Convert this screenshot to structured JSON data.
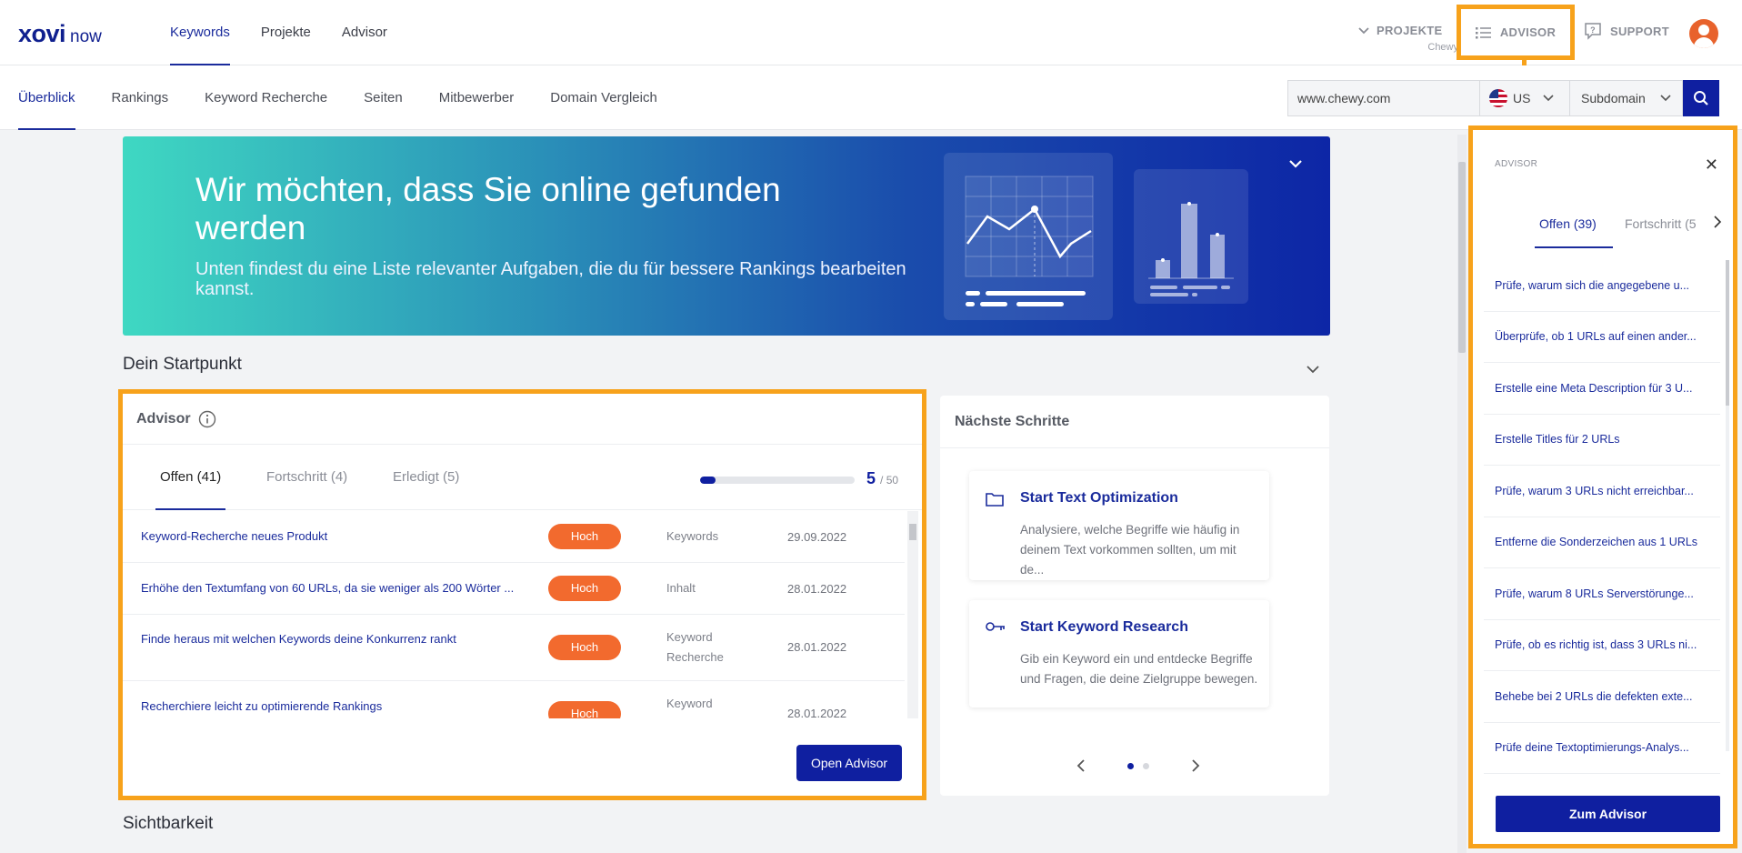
{
  "header": {
    "logo_main": "xovi",
    "logo_sub": "now",
    "nav": [
      {
        "label": "Keywords"
      },
      {
        "label": "Projekte"
      },
      {
        "label": "Advisor"
      }
    ],
    "projekte_label": "PROJEKTE",
    "projekte_sub": "Chewy",
    "advisor_label": "ADVISOR",
    "support_label": "SUPPORT",
    "accent": "#1a2b9c",
    "highlight": "#f7a21b"
  },
  "subnav": {
    "items": [
      {
        "label": "Überblick"
      },
      {
        "label": "Rankings"
      },
      {
        "label": "Keyword Recherche"
      },
      {
        "label": "Seiten"
      },
      {
        "label": "Mitbewerber"
      },
      {
        "label": "Domain Vergleich"
      }
    ],
    "domain_value": "www.chewy.com",
    "country": "US",
    "scope": "Subdomain"
  },
  "hero": {
    "title": "Wir möchten, dass Sie online gefunden werden",
    "subtitle": "Unten findest du eine Liste relevanter Aufgaben, die du für bessere Rankings bearbeiten kannst."
  },
  "sections": {
    "start": "Dein Startpunkt",
    "visibility": "Sichtbarkeit"
  },
  "advisor": {
    "title": "Advisor",
    "tabs": [
      {
        "label": "Offen (41)"
      },
      {
        "label": "Fortschritt (4)"
      },
      {
        "label": "Erledigt (5)"
      }
    ],
    "progress_done": "5",
    "progress_total": "/ 50",
    "progress_fraction": 0.1,
    "tasks": [
      {
        "title": "Keyword-Recherche neues Produkt",
        "priority": "Hoch",
        "category": "Keywords",
        "date": "29.09.2022"
      },
      {
        "title": "Erhöhe den Textumfang von 60 URLs, da sie weniger als 200 Wörter ...",
        "priority": "Hoch",
        "category": "Inhalt",
        "date": "28.01.2022"
      },
      {
        "title": "Finde heraus mit welchen Keywords deine Konkurrenz rankt",
        "priority": "Hoch",
        "category": "Keyword Recherche",
        "date": "28.01.2022"
      },
      {
        "title": "Recherchiere leicht zu optimierende Rankings",
        "priority": "Hoch",
        "category": "Keyword",
        "date": "28.01.2022"
      }
    ],
    "open_button": "Open Advisor",
    "priority_color": "#f26a2e"
  },
  "next_steps": {
    "title": "Nächste Schritte",
    "cards": [
      {
        "icon": "folder-icon",
        "title": "Start Text Optimization",
        "desc": "Analysiere, welche Begriffe wie häufig in deinem Text vorkommen sollten, um mit de..."
      },
      {
        "icon": "key-icon",
        "title": "Start Keyword Research",
        "desc": "Gib ein Keyword ein und entdecke Begriffe und Fragen, die deine Zielgruppe bewegen."
      }
    ]
  },
  "drawer": {
    "label": "ADVISOR",
    "tabs": [
      {
        "label": "Offen (39)"
      },
      {
        "label": "Fortschritt (5"
      }
    ],
    "items": [
      "Prüfe, warum sich die angegebene u...",
      "Überprüfe, ob 1 URLs auf einen ander...",
      "Erstelle eine Meta Description für 3 U...",
      "Erstelle Titles für 2 URLs",
      "Prüfe, warum 3 URLs nicht erreichbar...",
      "Entferne die Sonderzeichen aus 1 URLs",
      "Prüfe, warum 8 URLs Serverstörunge...",
      "Prüfe, ob es richtig ist, dass 3 URLs ni...",
      "Behebe bei 2 URLs die defekten exte...",
      "Prüfe deine Textoptimierungs-Analys..."
    ],
    "button": "Zum Advisor"
  }
}
